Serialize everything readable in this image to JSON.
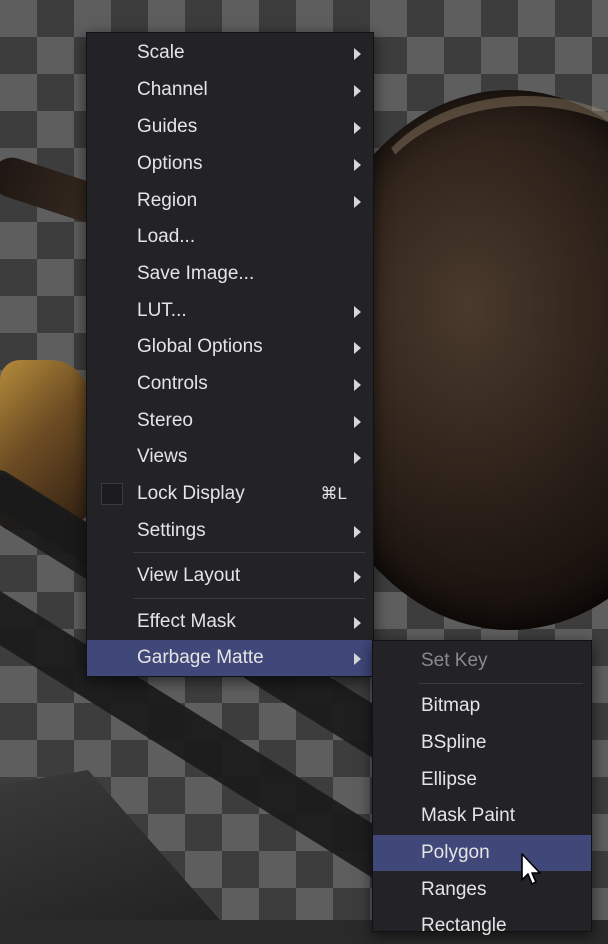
{
  "context_menu": {
    "items": [
      {
        "label": "Scale",
        "submenu": true
      },
      {
        "label": "Channel",
        "submenu": true
      },
      {
        "label": "Guides",
        "submenu": true
      },
      {
        "label": "Options",
        "submenu": true
      },
      {
        "label": "Region",
        "submenu": true
      },
      {
        "label": "Load...",
        "submenu": false
      },
      {
        "label": "Save Image...",
        "submenu": false
      },
      {
        "label": "LUT...",
        "submenu": true
      },
      {
        "label": "Global Options",
        "submenu": true
      },
      {
        "label": "Controls",
        "submenu": true
      },
      {
        "label": "Stereo",
        "submenu": true
      },
      {
        "label": "Views",
        "submenu": true
      },
      {
        "label": "Lock Display",
        "submenu": false,
        "checkbox": true,
        "checked": false,
        "shortcut": "⌘L"
      },
      {
        "label": "Settings",
        "submenu": true
      },
      {
        "label": "View Layout",
        "submenu": true
      },
      {
        "label": "Effect Mask",
        "submenu": true
      },
      {
        "label": "Garbage Matte",
        "submenu": true,
        "highlighted": true
      }
    ]
  },
  "garbage_matte_submenu": {
    "items": [
      {
        "label": "Set Key",
        "disabled": true
      },
      {
        "label": "Bitmap"
      },
      {
        "label": "BSpline"
      },
      {
        "label": "Ellipse"
      },
      {
        "label": "Mask Paint"
      },
      {
        "label": "Polygon",
        "highlighted": true
      },
      {
        "label": "Ranges"
      },
      {
        "label": "Rectangle"
      }
    ]
  },
  "colors": {
    "menu_background": "#232327",
    "highlight": "#40487a",
    "text": "#e4e4e4",
    "disabled_text": "#8a8a8e"
  }
}
